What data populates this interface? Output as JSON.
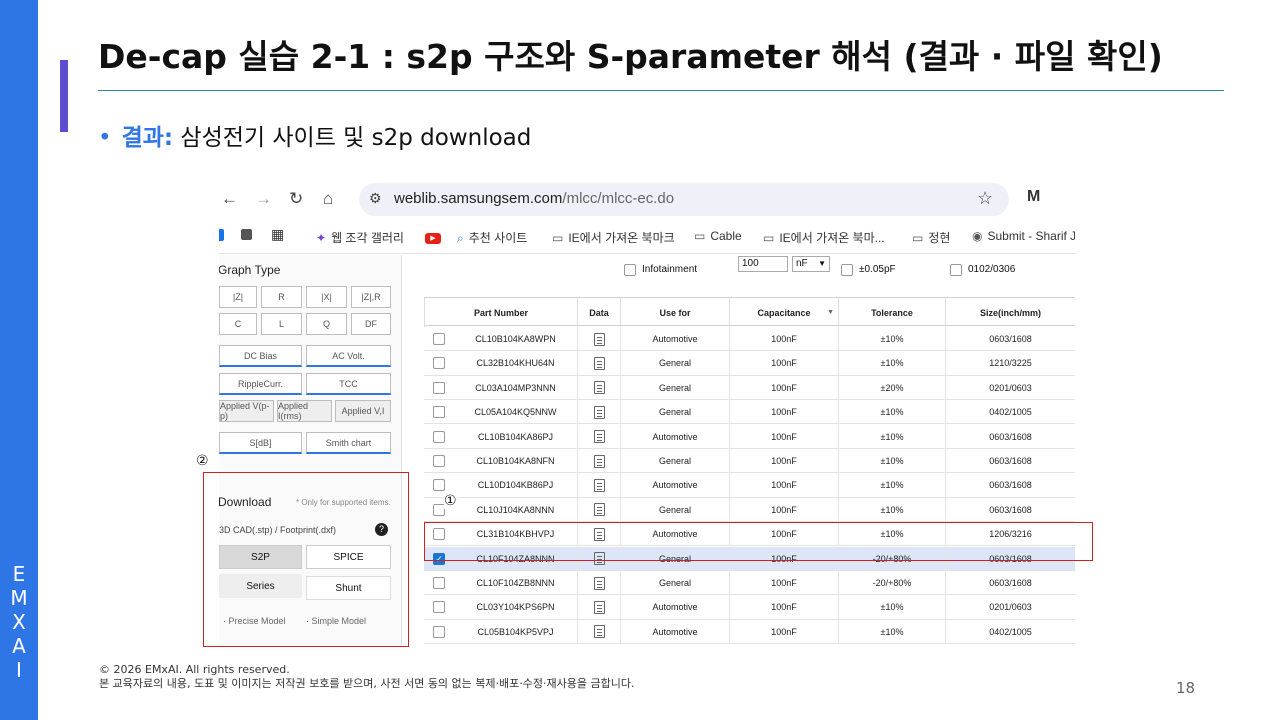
{
  "slide": {
    "title": "De-cap 실습 2-1 : s2p 구조와 S-parameter 해석 (결과 · 파일 확인)",
    "bullet_keyword": "결과:",
    "bullet_text": " 삼성전기 사이트 및 s2p download",
    "sidebar_letters": [
      "E",
      "M",
      "X",
      "A",
      "I"
    ],
    "footer_line1": "© 2026 EMxAI. All rights reserved.",
    "footer_line2": "본 교육자료의 내용, 도표 및 이미지는 저작권 보호를 받으며, 사전 서면 동의 없는 복제·배포·수정·재사용을 금합니다.",
    "page_number": "18",
    "annotation_1": "①",
    "annotation_2": "②",
    "colors": {
      "accent": "#2E75E6",
      "title_bar": "#5B4FD0",
      "rule": "#2C8C95",
      "highlight": "#D02020"
    }
  },
  "browser": {
    "url_host": "weblib.samsungsem.com",
    "url_path": "/mlcc/mlcc-ec.do",
    "bookmarks": [
      "웹 조각 갤러리",
      "추천 사이트",
      "IE에서 가져온 북마크",
      "Cable",
      "IE에서 가져온 북마...",
      "정현",
      "Submit - Sharif J"
    ]
  },
  "left_panel": {
    "graph_type_label": "Graph Type",
    "graph_buttons": [
      "|Z|",
      "R",
      "|X|",
      "|Z|,R",
      "C",
      "L",
      "Q",
      "DF",
      "DC Bias",
      "AC Volt.",
      "RippleCurr.",
      "TCC",
      "Applied V(p-p)",
      "Applied I(rms)",
      "Applied V,I",
      "S[dB]",
      "Smith chart"
    ],
    "download_label": "Download",
    "download_note": "* Only for supported items.",
    "cad_label": "3D CAD(.stp) / Footprint(.dxf)",
    "s2p_label": "S2P",
    "spice_label": "SPICE",
    "series_label": "Series",
    "shunt_label": "Shunt",
    "precise_label": "· Precise Model",
    "simple_label": "· Simple Model"
  },
  "filters": {
    "infotainment": "Infotainment",
    "cap_value": "100",
    "cap_unit": "nF",
    "tolerance": "±0.05pF",
    "size": "0102/0306"
  },
  "table": {
    "headers": [
      "Part Number",
      "Data",
      "Use for",
      "Capacitance",
      "Tolerance",
      "Size(inch/mm)"
    ],
    "rows": [
      {
        "part": "CL10B104KA8WPN",
        "use": "Automotive",
        "cap": "100nF",
        "tol": "±10%",
        "size": "0603/1608",
        "checked": false
      },
      {
        "part": "CL32B104KHU64N",
        "use": "General",
        "cap": "100nF",
        "tol": "±10%",
        "size": "1210/3225",
        "checked": false
      },
      {
        "part": "CL03A104MP3NNN",
        "use": "General",
        "cap": "100nF",
        "tol": "±20%",
        "size": "0201/0603",
        "checked": false
      },
      {
        "part": "CL05A104KQ5NNW",
        "use": "General",
        "cap": "100nF",
        "tol": "±10%",
        "size": "0402/1005",
        "checked": false
      },
      {
        "part": "CL10B104KA86PJ",
        "use": "Automotive",
        "cap": "100nF",
        "tol": "±10%",
        "size": "0603/1608",
        "checked": false
      },
      {
        "part": "CL10B104KA8NFN",
        "use": "General",
        "cap": "100nF",
        "tol": "±10%",
        "size": "0603/1608",
        "checked": false
      },
      {
        "part": "CL10D104KB86PJ",
        "use": "Automotive",
        "cap": "100nF",
        "tol": "±10%",
        "size": "0603/1608",
        "checked": false
      },
      {
        "part": "CL10J104KA8NNN",
        "use": "General",
        "cap": "100nF",
        "tol": "±10%",
        "size": "0603/1608",
        "checked": false
      },
      {
        "part": "CL31B104KBHVPJ",
        "use": "Automotive",
        "cap": "100nF",
        "tol": "±10%",
        "size": "1206/3216",
        "checked": false
      },
      {
        "part": "CL10F104ZA8NNN",
        "use": "General",
        "cap": "100nF",
        "tol": "-20/+80%",
        "size": "0603/1608",
        "checked": true
      },
      {
        "part": "CL10F104ZB8NNN",
        "use": "General",
        "cap": "100nF",
        "tol": "-20/+80%",
        "size": "0603/1608",
        "checked": false
      },
      {
        "part": "CL03Y104KPS6PN",
        "use": "Automotive",
        "cap": "100nF",
        "tol": "±10%",
        "size": "0201/0603",
        "checked": false
      },
      {
        "part": "CL05B104KP5VPJ",
        "use": "Automotive",
        "cap": "100nF",
        "tol": "±10%",
        "size": "0402/1005",
        "checked": false
      }
    ]
  }
}
